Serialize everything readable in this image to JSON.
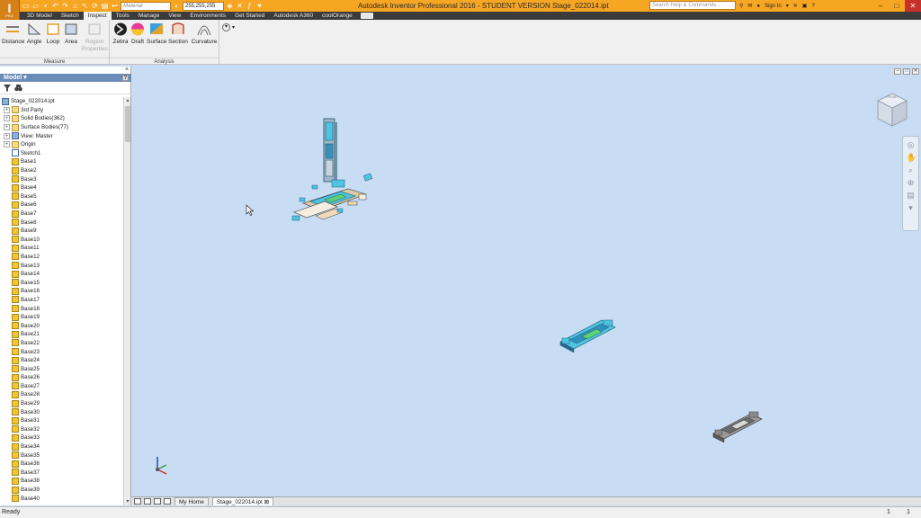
{
  "app": {
    "logo_letter": "I",
    "logo_sub": "PRO",
    "window_title": "Autodesk Inventor Professional 2016 - STUDENT VERSION    Stage_022014.ipt",
    "material_placeholder": "Material",
    "color_value": "255,255,255",
    "search_placeholder": "Search Help & Commands...",
    "sign_in": "Sign In",
    "help": "?"
  },
  "menu": {
    "tabs": [
      "3D Model",
      "Sketch",
      "Inspect",
      "Tools",
      "Manage",
      "View",
      "Environments",
      "Get Started",
      "Autodesk A360",
      "coolOrange"
    ],
    "active": "Inspect"
  },
  "ribbon": {
    "measure": {
      "label": "Measure",
      "buttons": [
        {
          "label": "Distance"
        },
        {
          "label": "Angle"
        },
        {
          "label": "Loop"
        },
        {
          "label": "Area"
        },
        {
          "label": "Region Properties"
        }
      ]
    },
    "analysis": {
      "label": "Analysis",
      "buttons": [
        {
          "label": "Zebra"
        },
        {
          "label": "Draft"
        },
        {
          "label": "Surface"
        },
        {
          "label": "Section"
        },
        {
          "label": "Curvature"
        }
      ]
    }
  },
  "browser": {
    "title": "Model ▾",
    "help": "?",
    "close": "×",
    "root": "Stage_022014.ipt",
    "nodes": [
      {
        "label": "3rd Party",
        "icon": "folder",
        "expand": "+"
      },
      {
        "label": "Solid Bodies(362)",
        "icon": "folder",
        "expand": "+"
      },
      {
        "label": "Surface Bodies(77)",
        "icon": "folder",
        "expand": "+"
      },
      {
        "label": "View: Master",
        "icon": "part",
        "expand": "+"
      },
      {
        "label": "Origin",
        "icon": "folder",
        "expand": "+"
      },
      {
        "label": "Sketch1",
        "icon": "sketch",
        "expand": ""
      },
      {
        "label": "Base1",
        "icon": "base",
        "expand": ""
      },
      {
        "label": "Base2",
        "icon": "base",
        "expand": ""
      },
      {
        "label": "Base3",
        "icon": "base",
        "expand": ""
      },
      {
        "label": "Base4",
        "icon": "base",
        "expand": ""
      },
      {
        "label": "Base5",
        "icon": "base",
        "expand": ""
      },
      {
        "label": "Base6",
        "icon": "base",
        "expand": ""
      },
      {
        "label": "Base7",
        "icon": "base",
        "expand": ""
      },
      {
        "label": "Base8",
        "icon": "base",
        "expand": ""
      },
      {
        "label": "Base9",
        "icon": "base",
        "expand": ""
      },
      {
        "label": "Base10",
        "icon": "base",
        "expand": ""
      },
      {
        "label": "Base11",
        "icon": "base",
        "expand": ""
      },
      {
        "label": "Base12",
        "icon": "base",
        "expand": ""
      },
      {
        "label": "Base13",
        "icon": "base",
        "expand": ""
      },
      {
        "label": "Base14",
        "icon": "base",
        "expand": ""
      },
      {
        "label": "Base15",
        "icon": "base",
        "expand": ""
      },
      {
        "label": "Base16",
        "icon": "base",
        "expand": ""
      },
      {
        "label": "Base17",
        "icon": "base",
        "expand": ""
      },
      {
        "label": "Base18",
        "icon": "base",
        "expand": ""
      },
      {
        "label": "Base19",
        "icon": "base",
        "expand": ""
      },
      {
        "label": "Base20",
        "icon": "base",
        "expand": ""
      },
      {
        "label": "Base21",
        "icon": "base",
        "expand": ""
      },
      {
        "label": "Base22",
        "icon": "base",
        "expand": ""
      },
      {
        "label": "Base23",
        "icon": "base",
        "expand": ""
      },
      {
        "label": "Base24",
        "icon": "base",
        "expand": ""
      },
      {
        "label": "Base25",
        "icon": "base",
        "expand": ""
      },
      {
        "label": "Base26",
        "icon": "base",
        "expand": ""
      },
      {
        "label": "Base27",
        "icon": "base",
        "expand": ""
      },
      {
        "label": "Base28",
        "icon": "base",
        "expand": ""
      },
      {
        "label": "Base29",
        "icon": "base",
        "expand": ""
      },
      {
        "label": "Base30",
        "icon": "base",
        "expand": ""
      },
      {
        "label": "Base31",
        "icon": "base",
        "expand": ""
      },
      {
        "label": "Base32",
        "icon": "base",
        "expand": ""
      },
      {
        "label": "Base33",
        "icon": "base",
        "expand": ""
      },
      {
        "label": "Base34",
        "icon": "base",
        "expand": ""
      },
      {
        "label": "Base35",
        "icon": "base",
        "expand": ""
      },
      {
        "label": "Base36",
        "icon": "base",
        "expand": ""
      },
      {
        "label": "Base37",
        "icon": "base",
        "expand": ""
      },
      {
        "label": "Base38",
        "icon": "base",
        "expand": ""
      },
      {
        "label": "Base39",
        "icon": "base",
        "expand": ""
      },
      {
        "label": "Base40",
        "icon": "base",
        "expand": ""
      }
    ]
  },
  "viewcube_label": "FRONT",
  "doc_tabs": [
    {
      "label": "My Home"
    },
    {
      "label": "Stage_022014.ipt ⊠"
    }
  ],
  "status": {
    "text": "Ready",
    "count1": "1",
    "count2": "1"
  },
  "colors": {
    "title_bar": "#f6a623",
    "menu_bar": "#3b3b3b",
    "viewport_bg": "#c8ddf4",
    "model_cyan": "#4fc3e0",
    "model_gray": "#8a8a8a"
  }
}
